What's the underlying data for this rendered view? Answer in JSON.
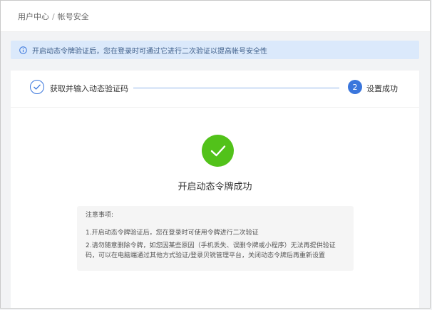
{
  "breadcrumb": {
    "items": [
      {
        "label": "用户中心"
      },
      {
        "label": "帐号安全"
      }
    ],
    "separator": "/"
  },
  "notice": {
    "icon": "info-circle-icon",
    "text": "开启动态令牌验证后，您在登录时可通过它进行二次验证以提高帐号安全性"
  },
  "steps": [
    {
      "label": "获取并输入动态验证码",
      "status": "done",
      "icon": "check-icon"
    },
    {
      "number": "2",
      "label": "设置成功",
      "status": "active"
    }
  ],
  "result": {
    "icon": "check-circle-icon",
    "title": "开启动态令牌成功"
  },
  "notes": {
    "heading": "注意事项:",
    "items": [
      "1.开启动态令牌验证后，您在登录时可使用令牌进行二次验证",
      "2.请勿随意删除令牌，如您因某些原因（手机丢失、误删令牌或小程序）无法再提供验证码，可以在电脑端通过其他方式验证/登录贝锐管理平台，关闭动态令牌后再重新设置"
    ]
  },
  "colors": {
    "primary": "#3a76dc",
    "success": "#52c21a",
    "notice_bg": "#dbe9fb"
  }
}
